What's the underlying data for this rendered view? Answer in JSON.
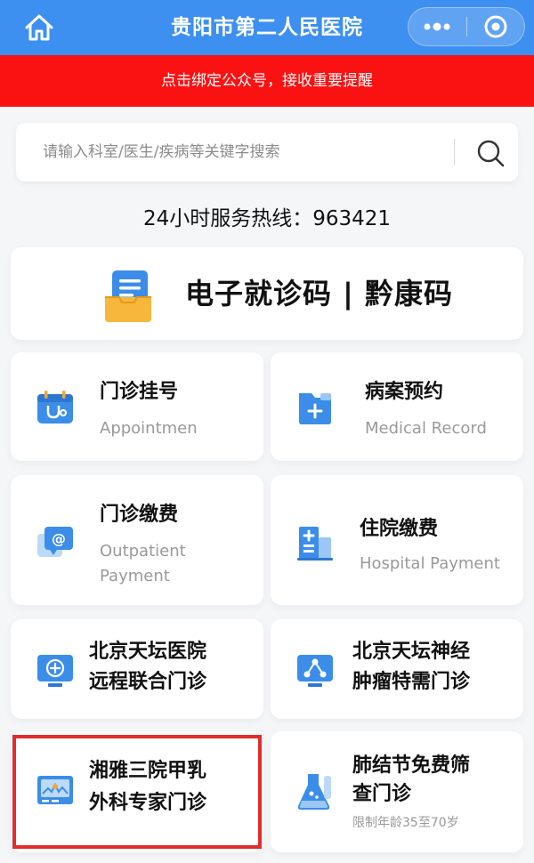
{
  "header": {
    "title": "贵阳市第二人民医院",
    "home_icon": "home-icon",
    "more_icon": "more-dots-icon",
    "close_icon": "target-close-icon",
    "bg_color": "#3d8ff0"
  },
  "banner": {
    "text": "点击绑定公众号，接收重要提醒",
    "bg_color": "#fa1212"
  },
  "search": {
    "placeholder": "请输入科室/医生/疾病等关键字搜索",
    "icon": "search-icon"
  },
  "hotline": "24小时服务热线：963421",
  "health_code": {
    "label": "电子就诊码 | 黔康码",
    "icon": "document-tray-icon"
  },
  "services": [
    {
      "title": "门诊挂号",
      "subtitle": "Appointmen",
      "icon": "calendar-stethoscope-icon"
    },
    {
      "title": "病案预约",
      "subtitle": "Medical Record",
      "icon": "medical-folder-icon"
    },
    {
      "title": "门诊缴费",
      "subtitle_line1": "Outpatient",
      "subtitle_line2": "Payment",
      "icon": "payment-chat-icon"
    },
    {
      "title": "住院缴费",
      "subtitle": "Hospital Payment",
      "icon": "hospital-building-icon"
    },
    {
      "title_line1": "北京天坛医院",
      "title_line2": "远程联合门诊",
      "icon": "monitor-remote-icon"
    },
    {
      "title_line1": "北京天坛神经",
      "title_line2": "肿瘤特需门诊",
      "icon": "monitor-network-icon"
    },
    {
      "title_line1": "湘雅三院甲乳",
      "title_line2": "外科专家门诊",
      "icon": "ultrasound-monitor-icon"
    },
    {
      "title_line1": "肺结节免费筛",
      "title_line2": "查门诊",
      "note": "限制年龄35至70岁",
      "icon": "lab-flask-icon"
    }
  ]
}
